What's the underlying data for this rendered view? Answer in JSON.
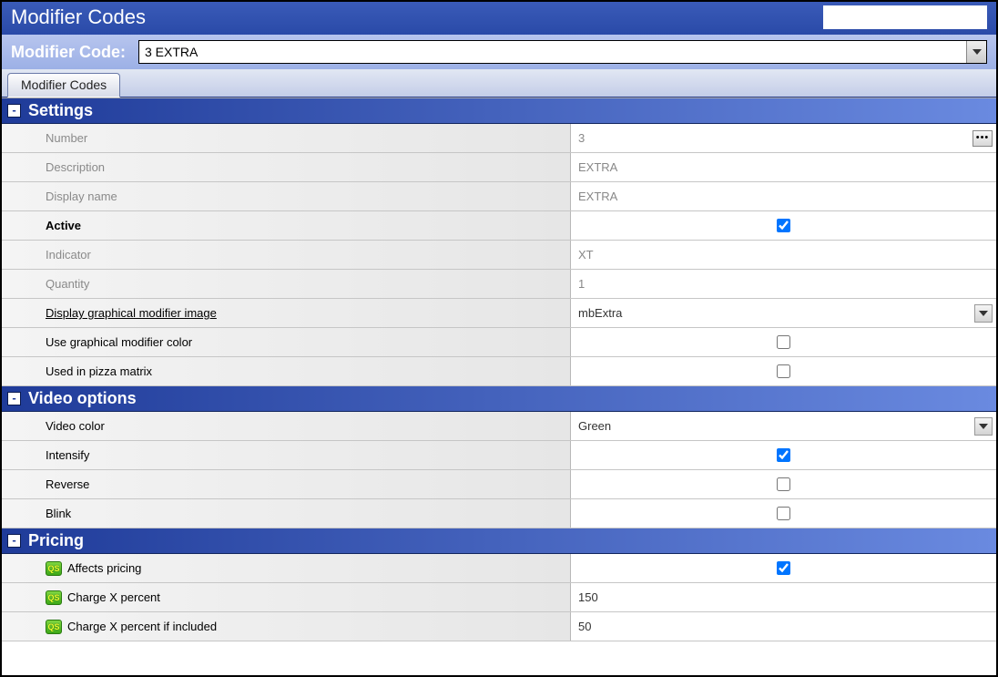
{
  "window": {
    "title": "Modifier Codes"
  },
  "selector": {
    "label": "Modifier Code:",
    "value": "3 EXTRA"
  },
  "tabs": {
    "main": "Modifier Codes"
  },
  "sections": {
    "settings": {
      "title": "Settings",
      "rows": {
        "number": {
          "label": "Number",
          "value": "3"
        },
        "description": {
          "label": "Description",
          "value": "EXTRA"
        },
        "display_name": {
          "label": "Display name",
          "value": "EXTRA"
        },
        "active": {
          "label": "Active",
          "checked": true
        },
        "indicator": {
          "label": "Indicator",
          "value": "XT"
        },
        "quantity": {
          "label": "Quantity",
          "value": "1"
        },
        "graphical_image": {
          "label": "Display graphical modifier image",
          "value": "mbExtra"
        },
        "use_graphical_color": {
          "label": "Use graphical modifier color",
          "checked": false
        },
        "used_in_pizza": {
          "label": "Used in pizza matrix",
          "checked": false
        }
      }
    },
    "video": {
      "title": "Video options",
      "rows": {
        "video_color": {
          "label": "Video color",
          "value": "Green"
        },
        "intensify": {
          "label": "Intensify",
          "checked": true
        },
        "reverse": {
          "label": "Reverse",
          "checked": false
        },
        "blink": {
          "label": "Blink",
          "checked": false
        }
      }
    },
    "pricing": {
      "title": "Pricing",
      "rows": {
        "affects_pricing": {
          "label": "Affects pricing",
          "checked": true
        },
        "charge_x_percent": {
          "label": "Charge X percent",
          "value": "150"
        },
        "charge_x_percent_included": {
          "label": "Charge X percent if included",
          "value": "50"
        }
      }
    }
  },
  "icons": {
    "qs": "QS"
  }
}
